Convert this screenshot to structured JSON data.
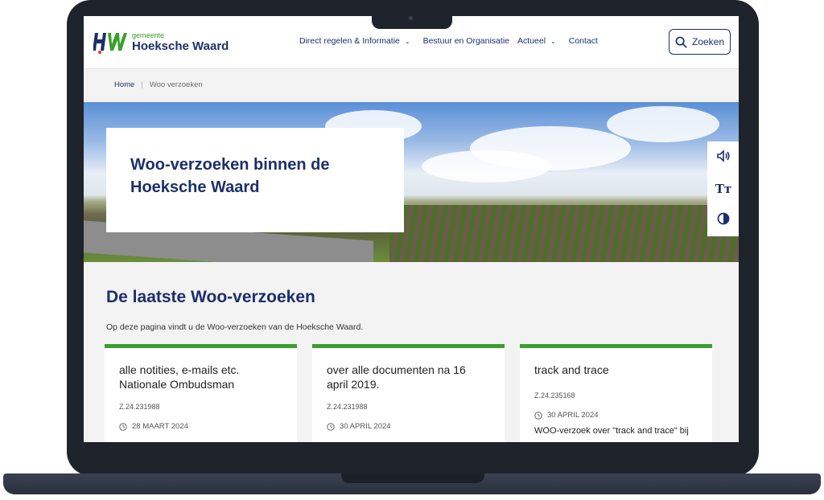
{
  "logo": {
    "small": "gemeente",
    "big": "Hoeksche Waard"
  },
  "nav": [
    {
      "label": "Direct regelen & Informatie",
      "dropdown": true
    },
    {
      "label": "Bestuur en Organisatie",
      "dropdown": false
    },
    {
      "label": "Actueel",
      "dropdown": true
    },
    {
      "label": "Contact",
      "dropdown": false
    }
  ],
  "search": {
    "label": "Zoeken",
    "icon": "search-icon"
  },
  "breadcrumb": {
    "home": "Home",
    "separator": "|",
    "current": "Woo verzoeken"
  },
  "hero": {
    "title_line1": "Woo-verzoeken binnen de",
    "title_line2": "Hoeksche Waard"
  },
  "tools": {
    "icons": [
      "speaker-icon",
      "text-size-icon",
      "contrast-icon"
    ],
    "text_size_glyph": "Tт"
  },
  "section": {
    "title": "De laatste Woo-verzoeken",
    "intro": "Op deze pagina vindt u de Woo-verzoeken van de Hoeksche Waard."
  },
  "cards": [
    {
      "title": "alle notities, e-mails etc. Nationale Ombudsman",
      "id": "Z.24.231988",
      "date": "28 MAART 2024",
      "desc": ""
    },
    {
      "title": "over alle documenten na 16 april 2019.",
      "id": "Z.24.231988",
      "date": "30 APRIL 2024",
      "desc": ""
    },
    {
      "title": "track and trace",
      "id": "Z.24.235168",
      "date": "30 APRIL 2024",
      "desc": "WOO-verzoek over \"track and trace\" bij"
    }
  ],
  "colors": {
    "brand_blue": "#1c2f6b",
    "brand_green": "#3aa02d"
  }
}
